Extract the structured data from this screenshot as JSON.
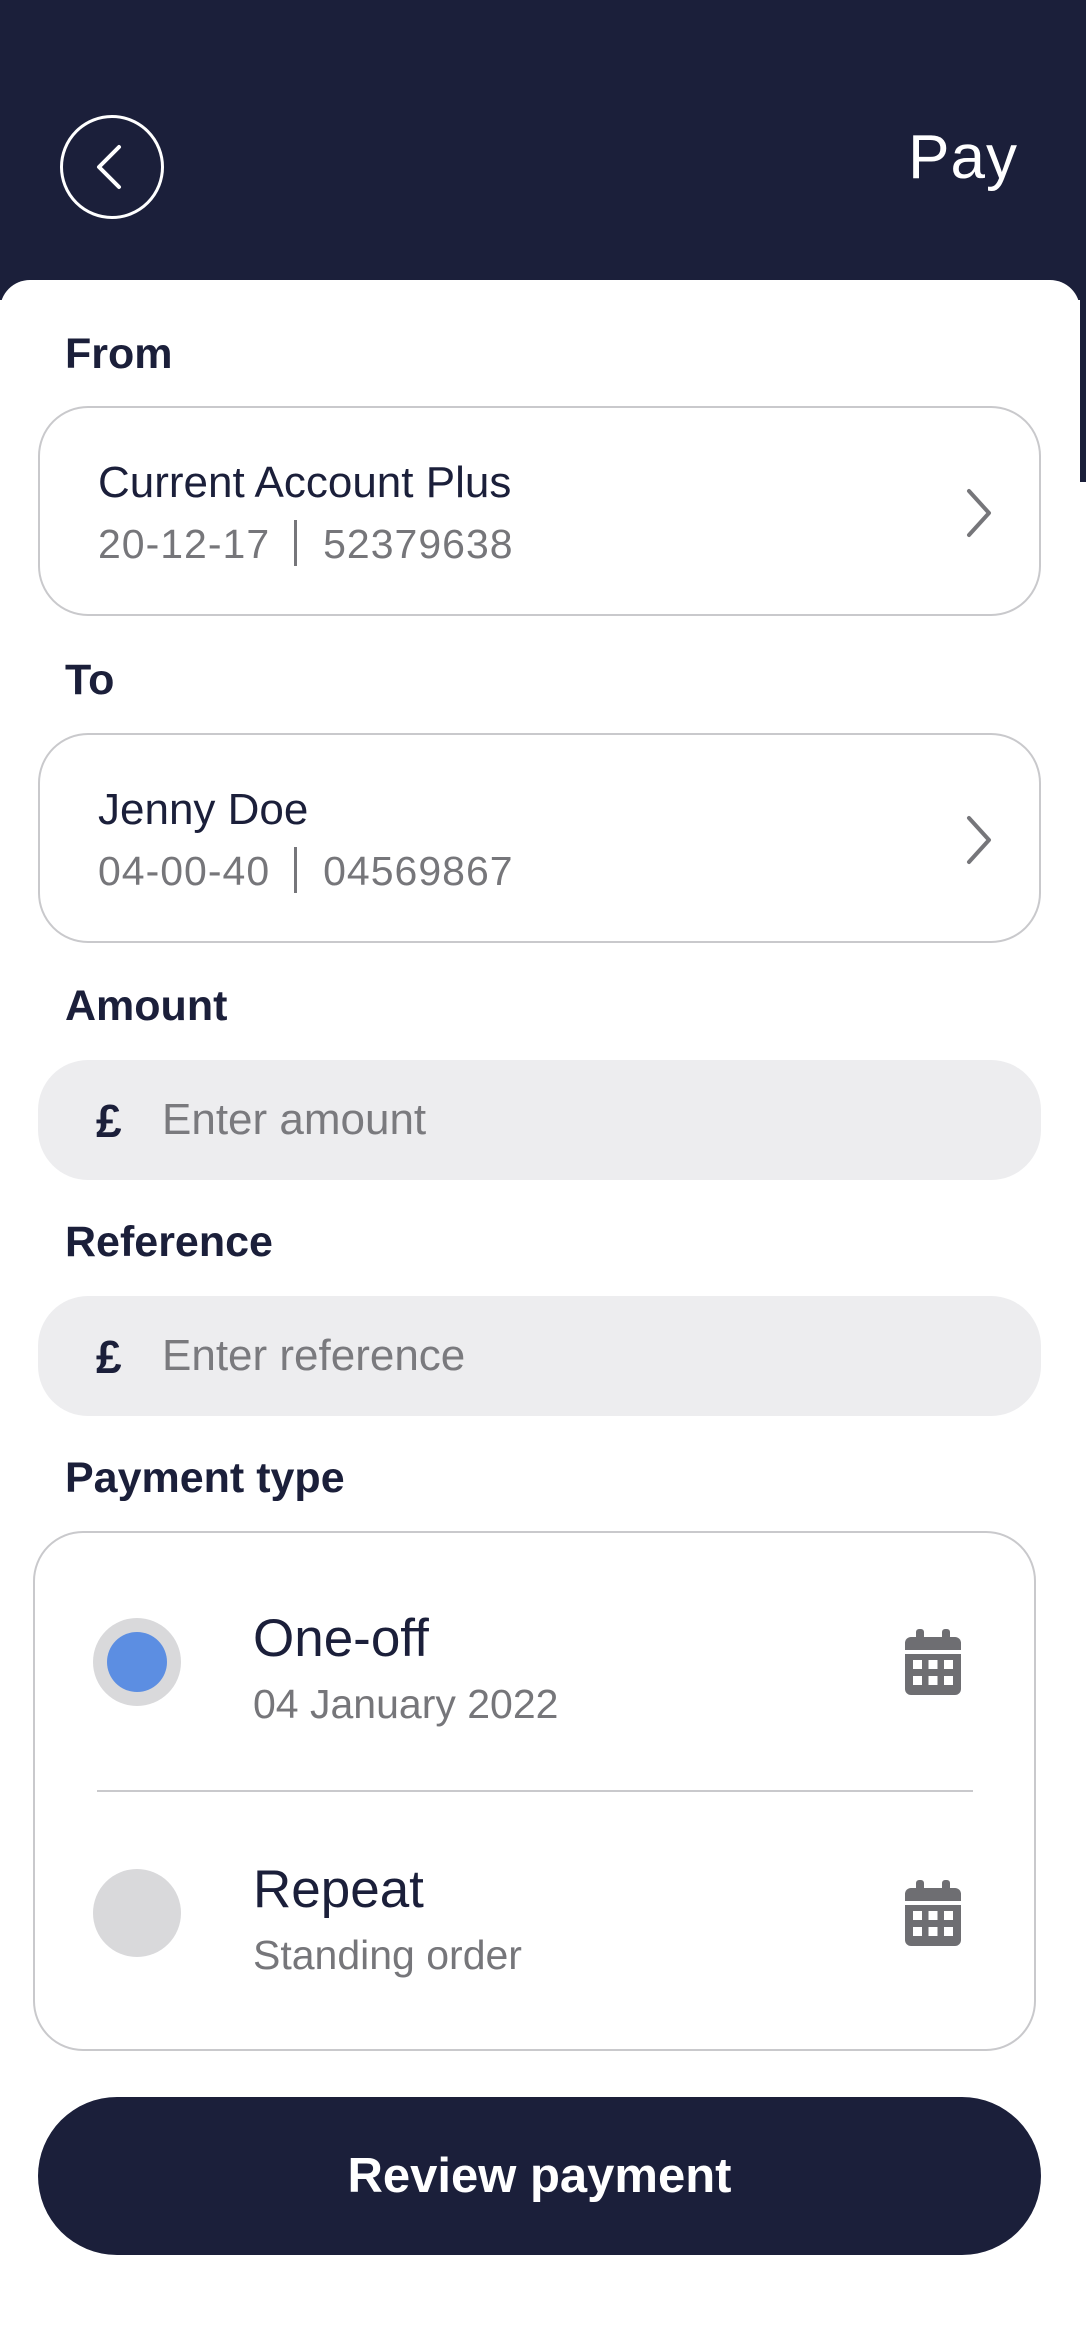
{
  "header": {
    "title": "Pay"
  },
  "from": {
    "label": "From",
    "account_name": "Current Account Plus",
    "sort_code": "20-12-17",
    "account_number": "52379638"
  },
  "to": {
    "label": "To",
    "payee_name": "Jenny Doe",
    "sort_code": "04-00-40",
    "account_number": "04569867"
  },
  "amount": {
    "label": "Amount",
    "currency_symbol": "£",
    "placeholder": "Enter amount",
    "value": ""
  },
  "reference": {
    "label": "Reference",
    "currency_symbol": "£",
    "placeholder": "Enter reference",
    "value": ""
  },
  "payment_type": {
    "label": "Payment type",
    "options": [
      {
        "title": "One-off",
        "subtitle": "04 January 2022",
        "selected": true
      },
      {
        "title": "Repeat",
        "subtitle": "Standing order",
        "selected": false
      }
    ]
  },
  "actions": {
    "review_label": "Review payment"
  },
  "colors": {
    "navy": "#1b1f3a",
    "radio_selected": "#5c8ee2",
    "radio_unselected": "#d9d9db",
    "muted_text": "#76767a",
    "input_bg": "#ededef"
  },
  "icons": {
    "back": "chevron-left-icon",
    "account_chevron": "chevron-right-icon",
    "calendar": "calendar-icon"
  }
}
